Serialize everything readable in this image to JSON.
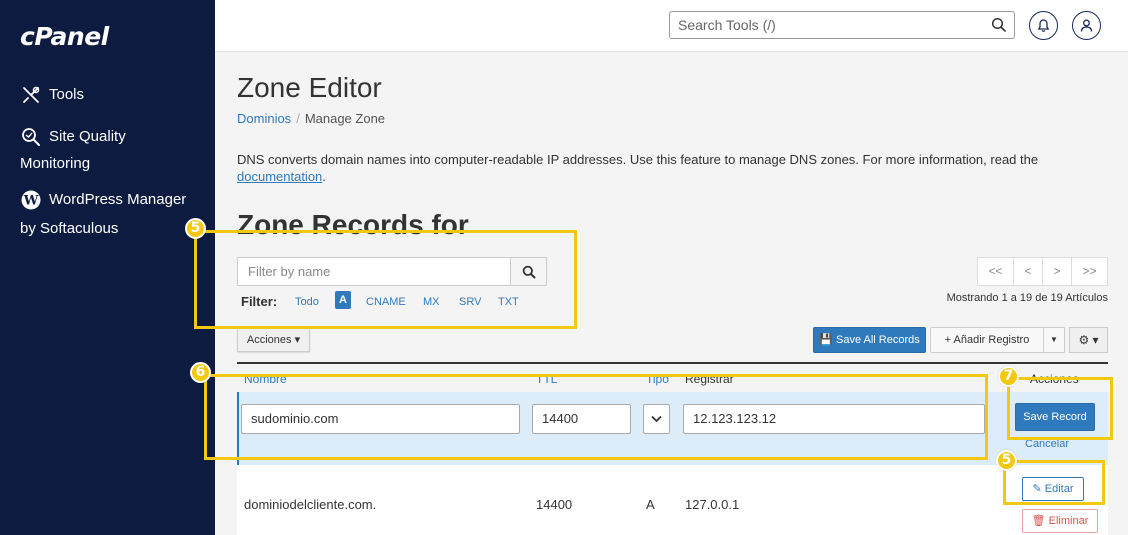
{
  "sidebar": {
    "logo": "cPanel",
    "items": [
      {
        "label": "Tools",
        "icon": "tools-icon"
      },
      {
        "label_line1": "Site Quality",
        "label_line2": "Monitoring",
        "icon": "site-quality-icon"
      },
      {
        "label_line1": "WordPress Manager",
        "label_line2": "by Softaculous",
        "icon": "wordpress-icon"
      }
    ]
  },
  "topbar": {
    "search_placeholder": "Search Tools (/)",
    "icons": [
      "search-icon",
      "bell-icon",
      "user-icon"
    ]
  },
  "page": {
    "title": "Zone Editor",
    "breadcrumb": {
      "parent": "Dominios",
      "current": "Manage Zone"
    },
    "description": "DNS converts domain names into computer-readable IP addresses. Use this feature to manage DNS zones. For more information, read the ",
    "description_link": "documentation",
    "description_end": ".",
    "section_title": "Zone Records for"
  },
  "filter": {
    "placeholder": "Filter by name",
    "label": "Filter:",
    "types": [
      "Todo",
      "A",
      "CNAME",
      "MX",
      "SRV",
      "TXT"
    ],
    "active": "A"
  },
  "pager": {
    "buttons": [
      "<<",
      "<",
      ">",
      ">>"
    ],
    "summary": "Mostrando 1 a 19 de 19 Artículos"
  },
  "toolbar": {
    "acciones": "Acciones ▾",
    "save_all": "Save All Records",
    "add_record": "+ Añadir Registro",
    "add_caret": "▼",
    "gear": "⚙ ▾"
  },
  "table": {
    "headers": {
      "name": "Nombre",
      "ttl": "TTL",
      "type": "Tipo",
      "record": "Registrar",
      "actions": "Acciones"
    },
    "edit_row": {
      "name": "sudominio.com",
      "ttl": "14400",
      "record": "12.123.123.12",
      "save": "Save Record",
      "cancel": "Cancelar"
    },
    "rows": [
      {
        "name": "dominiodelcliente.com.",
        "ttl": "14400",
        "type": "A",
        "record": "127.0.0.1",
        "edit": "✎ Editar",
        "delete": "🗑 Eliminar"
      }
    ]
  },
  "annotations": {
    "badge_filter": "5",
    "badge_edit_row": "6",
    "badge_save": "7",
    "badge_editar": "5",
    "color": "#f2c811"
  },
  "colors": {
    "sidebar": "#0d1b40",
    "accent": "#2f7abd",
    "highlight": "#f2c811"
  }
}
